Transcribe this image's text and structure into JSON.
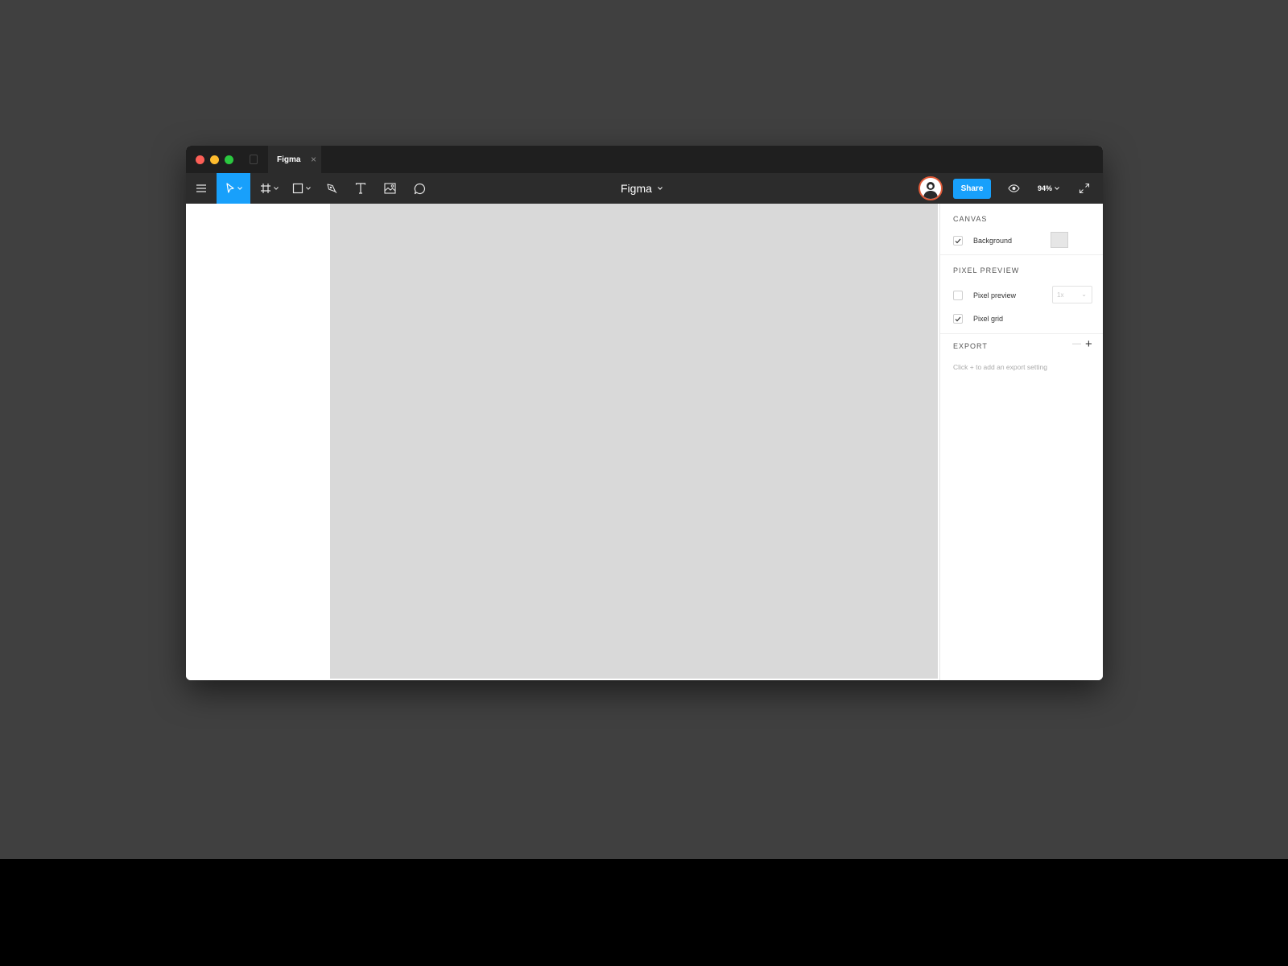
{
  "window": {
    "tab_title": "Figma",
    "tab_close": "×"
  },
  "toolbar": {
    "menu_icon": "hamburger-menu-icon",
    "tools": [
      "move-tool-icon",
      "frame-tool-icon",
      "rectangle-tool-icon",
      "pen-tool-icon",
      "text-tool-icon",
      "image-tool-icon",
      "comment-tool-icon"
    ],
    "active_tool": "move",
    "document_title": "Figma",
    "share_label": "Share",
    "zoom_label": "94%",
    "accent_color": "#18a0fb"
  },
  "properties": {
    "canvas": {
      "title": "CANVAS",
      "background_label": "Background",
      "background_checked": true,
      "background_color": "#e6e6e6"
    },
    "pixel_preview": {
      "title": "PIXEL PREVIEW",
      "preview_label": "Pixel preview",
      "preview_checked": false,
      "scale_value": "1x",
      "grid_label": "Pixel grid",
      "grid_checked": true
    },
    "export": {
      "title": "EXPORT",
      "minus": "—",
      "plus": "+",
      "hint": "Click + to add an export setting"
    }
  }
}
